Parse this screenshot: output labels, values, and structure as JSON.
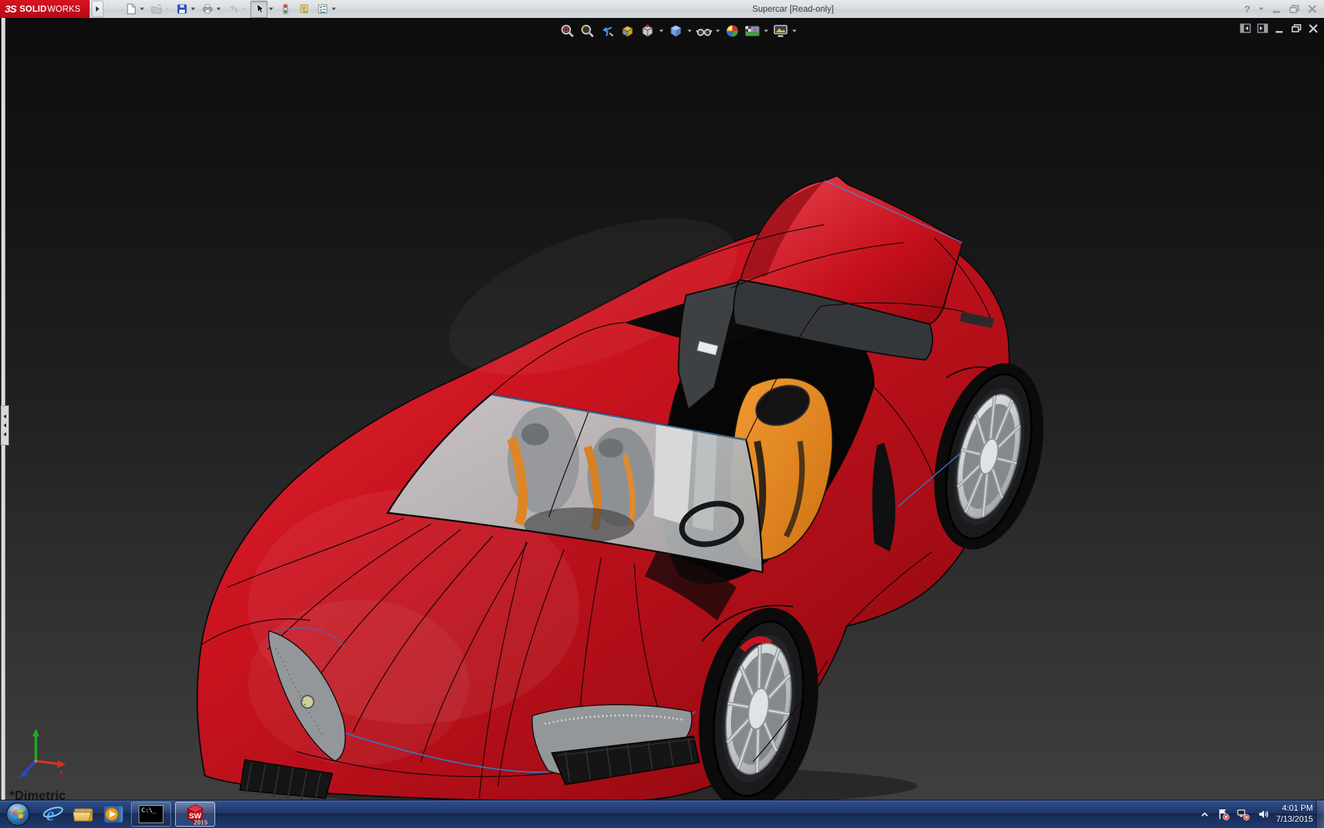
{
  "titlebar": {
    "logo_mark": "3S",
    "logo_bold": "SOLID",
    "logo_light": "WORKS",
    "title": "Supercar [Read-only]",
    "help_glyph": "?",
    "toolbar_icons": [
      "new-document",
      "open",
      "save",
      "print",
      "undo",
      "select",
      "rebuild-traffic-light",
      "file-properties",
      "options"
    ]
  },
  "viewport": {
    "headsup_icons": [
      "zoom-to-fit",
      "zoom-to-area",
      "previous-view",
      "section-view",
      "view-orientation",
      "display-style",
      "hide-show-items",
      "edit-appearance",
      "apply-scene",
      "view-settings"
    ],
    "view_label": "*Dimetric",
    "triad": {
      "x_label": "x",
      "x_color": "#d83020",
      "y_color": "#1fae1f",
      "z_color": "#2848d8"
    },
    "model": {
      "name": "Supercar",
      "body_color": "#c8101c",
      "seat_color": "#e8861c",
      "glass_color": "#b5b7b9",
      "edge_accent_color": "#4a86c8",
      "door_state": "open-butterfly-door"
    },
    "background_top": "#0d0d0d",
    "background_bottom": "#3f3f3f"
  },
  "taskbar": {
    "items": [
      {
        "name": "internet-explorer",
        "glyph": "e"
      },
      {
        "name": "file-explorer"
      },
      {
        "name": "windows-media-player"
      },
      {
        "name": "command-prompt",
        "label": "C:\\_",
        "state": "running"
      },
      {
        "name": "solidworks-2015",
        "label": "SW",
        "year": "2015",
        "state": "active"
      }
    ],
    "tray": {
      "icons": [
        "show-hidden-chevron",
        "action-center-flag",
        "network-disconnected",
        "volume"
      ],
      "time": "4:01 PM",
      "date": "7/13/2015"
    }
  }
}
